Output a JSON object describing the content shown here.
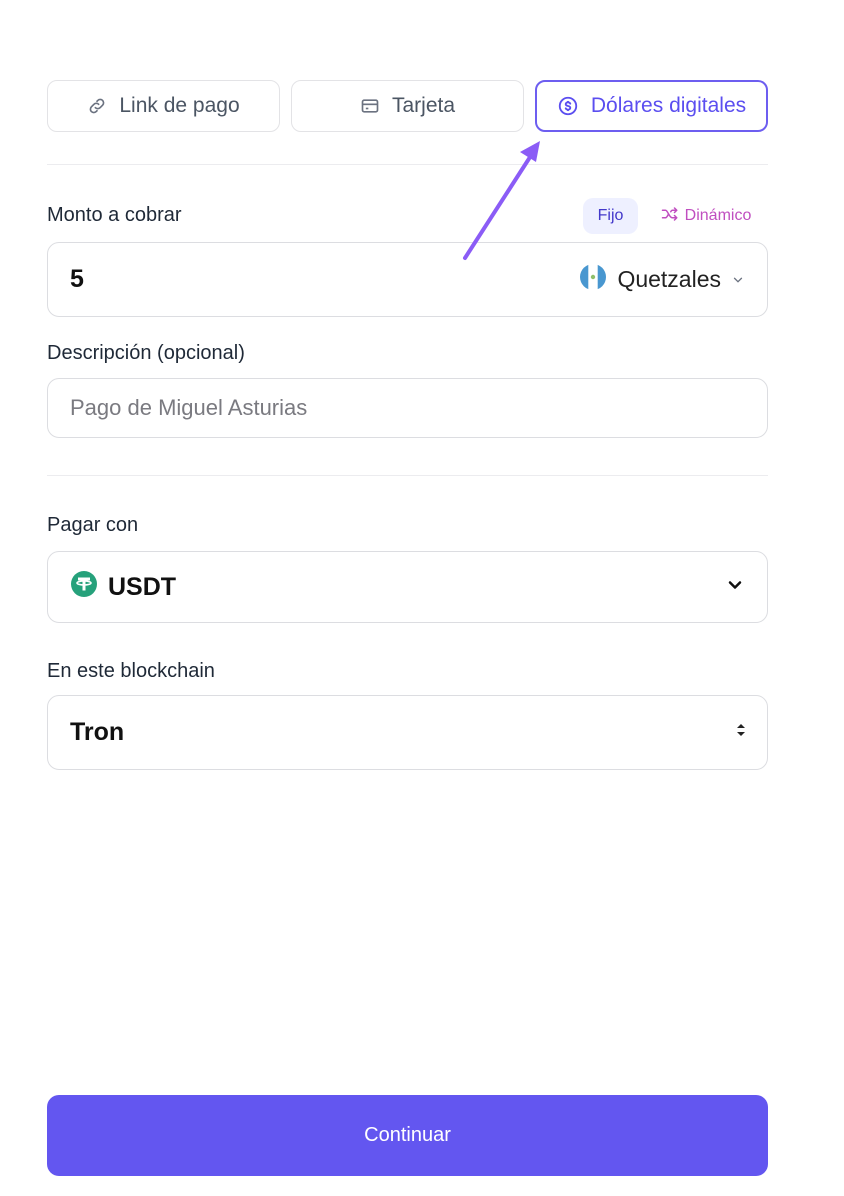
{
  "tabs": [
    {
      "label": "Link de pago",
      "icon": "link-icon"
    },
    {
      "label": "Tarjeta",
      "icon": "card-icon"
    },
    {
      "label": "Dólares digitales",
      "icon": "dollar-circle-icon",
      "active": true
    }
  ],
  "amount": {
    "label": "Monto a cobrar",
    "value": "5",
    "currency": "Quetzales",
    "currency_flag": "guatemala-flag-icon",
    "modes": {
      "fixed": "Fijo",
      "dynamic": "Dinámico",
      "selected": "fixed"
    }
  },
  "description": {
    "label": "Descripción (opcional)",
    "value": "",
    "placeholder": "Pago de Miguel Asturias"
  },
  "pay_with": {
    "label": "Pagar con",
    "value": "USDT",
    "icon": "tether-icon"
  },
  "blockchain": {
    "label": "En este blockchain",
    "value": "Tron"
  },
  "continue_label": "Continuar",
  "colors": {
    "accent": "#6356f0",
    "active_tab": "#5b4ef0",
    "dynamic_pink": "#c04fc0",
    "tether_green": "#26a17b",
    "annotation_arrow": "#8b5cf6"
  }
}
